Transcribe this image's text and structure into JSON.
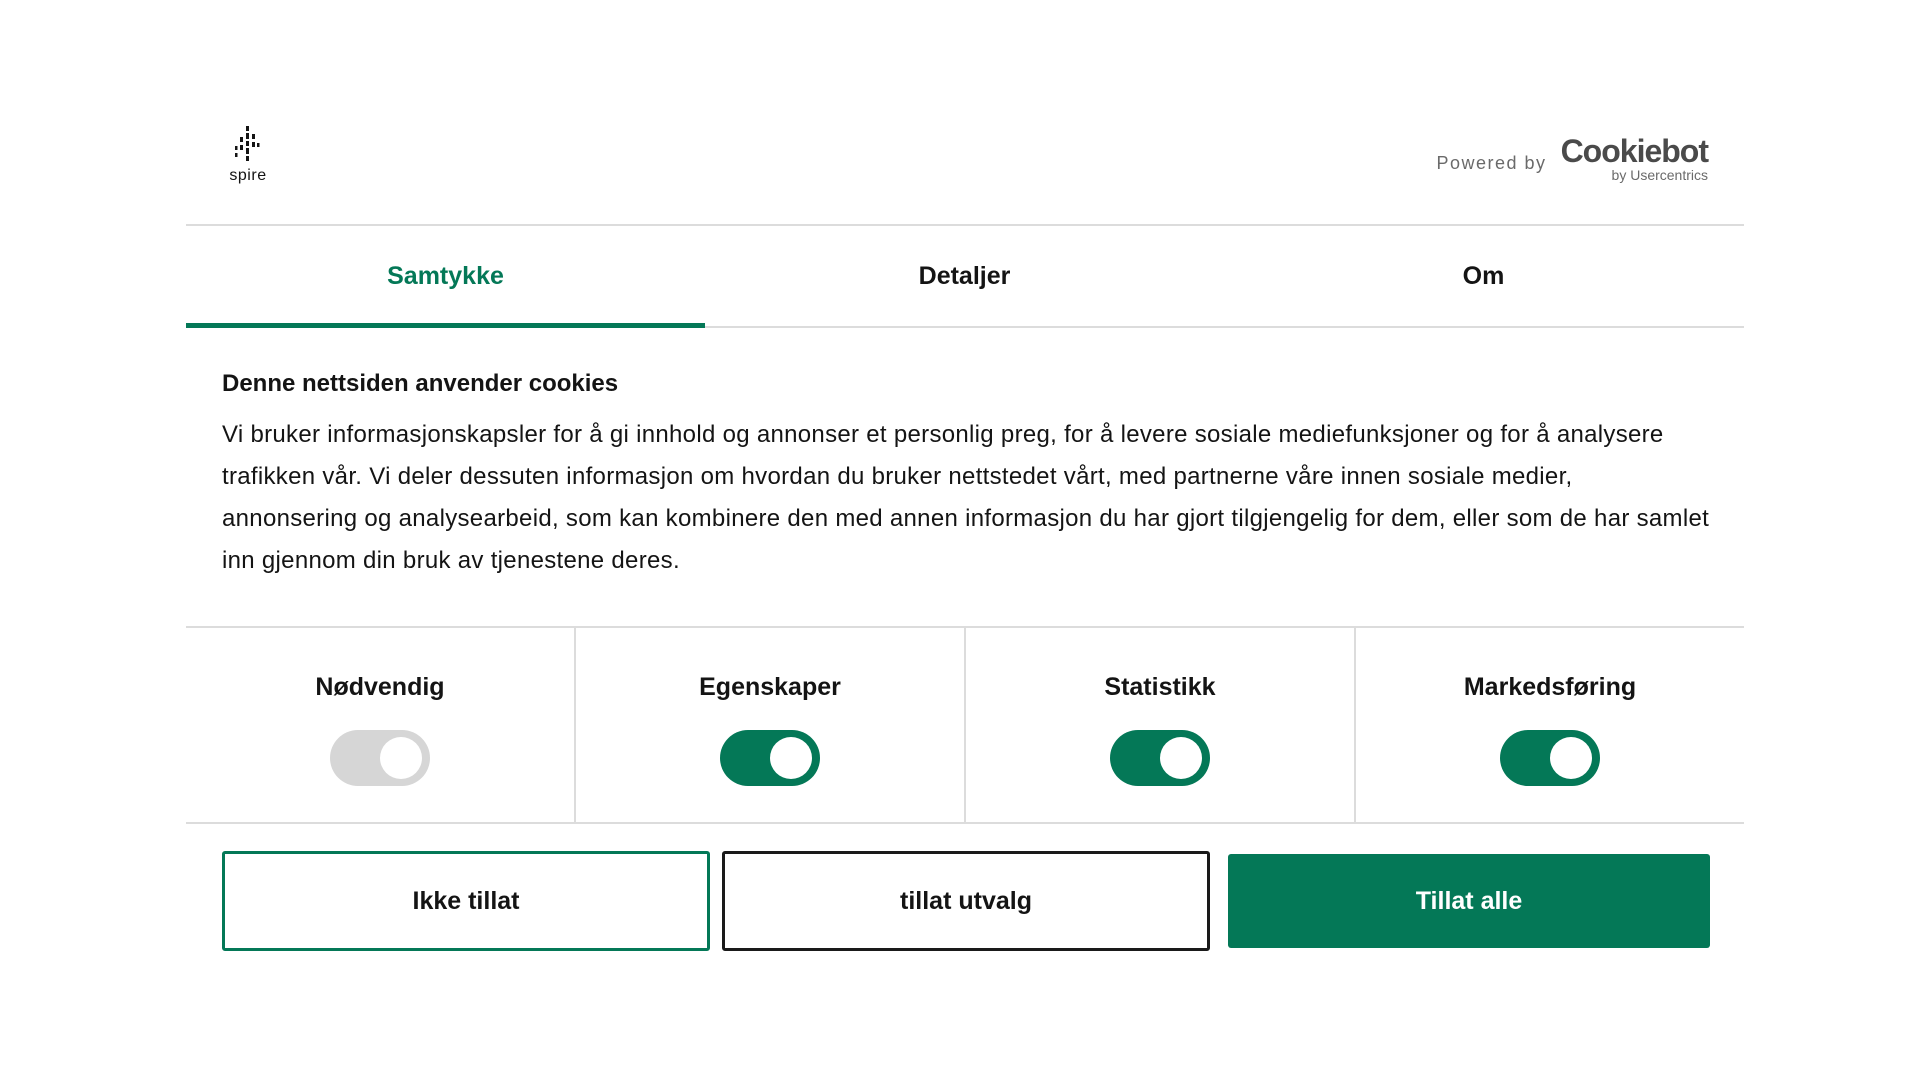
{
  "header": {
    "logo_text": "spire",
    "powered_by": "Powered by",
    "provider_name": "Cookiebot",
    "provider_sub": "by Usercentrics"
  },
  "tabs": [
    {
      "label": "Samtykke",
      "active": true
    },
    {
      "label": "Detaljer",
      "active": false
    },
    {
      "label": "Om",
      "active": false
    }
  ],
  "body": {
    "title": "Denne nettsiden anvender cookies",
    "text": "Vi bruker informasjonskapsler for å gi innhold og annonser et personlig preg, for å levere sosiale mediefunksjoner og for å analysere trafikken vår. Vi deler dessuten informasjon om hvordan du bruker nettstedet vårt, med partnerne våre innen sosiale medier, annonsering og analysearbeid, som kan kombinere den med annen informasjon du har gjort tilgjengelig for dem, eller som de har samlet inn gjennom din bruk av tjenestene deres."
  },
  "categories": [
    {
      "label": "Nødvendig",
      "enabled": true,
      "locked": true
    },
    {
      "label": "Egenskaper",
      "enabled": true,
      "locked": false
    },
    {
      "label": "Statistikk",
      "enabled": true,
      "locked": false
    },
    {
      "label": "Markedsføring",
      "enabled": true,
      "locked": false
    }
  ],
  "buttons": {
    "deny": "Ikke tillat",
    "allow_selection": "tillat utvalg",
    "allow_all": "Tillat alle"
  },
  "colors": {
    "accent": "#047857",
    "toggle_disabled": "#d6d6d6",
    "divider": "#dcdcdc"
  }
}
